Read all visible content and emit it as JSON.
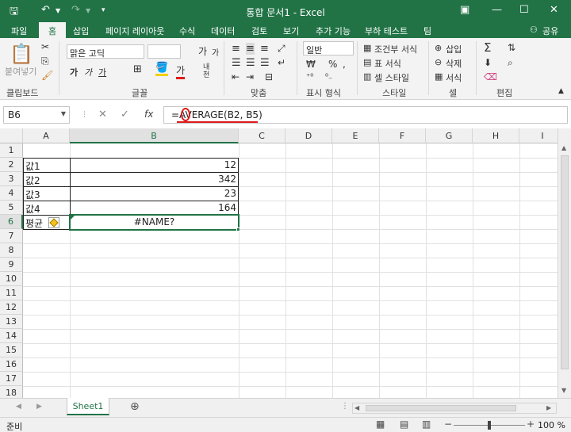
{
  "titlebar": {
    "title": "통합 문서1 - Excel"
  },
  "tabs": [
    "파일",
    "홈",
    "삽입",
    "페이지 레이아웃",
    "수식",
    "데이터",
    "검토",
    "보기",
    "추가 기능",
    "부하 테스트",
    "팀"
  ],
  "user": "공유",
  "ribbon": {
    "clipboard": {
      "paste": "붙여넣기",
      "label": "클립보드"
    },
    "font": {
      "name": "맑은 고딕",
      "label": "글꼴",
      "bold": "가",
      "italic": "가",
      "underline": "가",
      "grow": "가",
      "shrink": "가",
      "color": "가",
      "phonetic": "내천"
    },
    "align": {
      "label": "맞춤"
    },
    "number": {
      "format": "일반",
      "label": "표시 형식"
    },
    "styles": {
      "cond": "조건부 서식",
      "table": "표 서식",
      "cell": "셀 스타일",
      "label": "스타일"
    },
    "cells": {
      "insert": "삽입",
      "delete": "삭제",
      "format": "서식",
      "label": "셀"
    },
    "editing": {
      "label": "편집"
    }
  },
  "formula_bar": {
    "name_box": "B6",
    "cancel": "✕",
    "enter": "✓",
    "fx": "fx",
    "formula": "=AVERAGE(B2, B5)"
  },
  "columns": [
    "A",
    "B",
    "C",
    "D",
    "E",
    "F",
    "G",
    "H",
    "I"
  ],
  "rows": [
    "1",
    "2",
    "3",
    "4",
    "5",
    "6",
    "7",
    "8",
    "9",
    "10",
    "11",
    "12",
    "13",
    "14",
    "15",
    "16",
    "17",
    "18"
  ],
  "cells": {
    "a2": "값1",
    "b2": "12",
    "a3": "값2",
    "b3": "342",
    "a4": "값3",
    "b4": "23",
    "a5": "값4",
    "b5": "164",
    "a6": "평균",
    "b6": "#NAME?"
  },
  "sheet_tab": "Sheet1",
  "status": {
    "ready": "준비",
    "zoom": "100 %"
  },
  "colors": {
    "accent": "#217346",
    "error_mark": "#e01b1b"
  }
}
